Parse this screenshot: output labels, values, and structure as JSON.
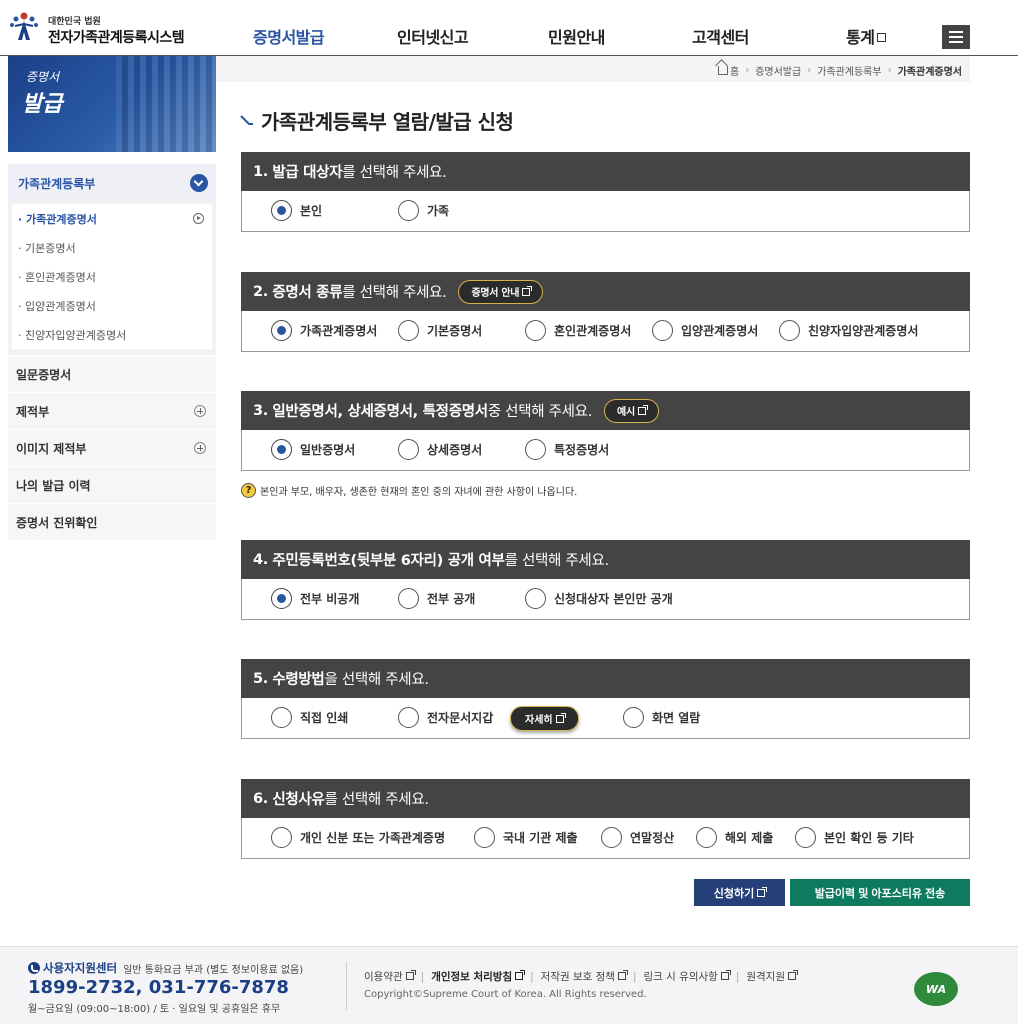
{
  "header": {
    "org_small": "대한민국 법원",
    "system_name": "전자가족관계등록시스템",
    "nav": [
      {
        "label": "증명서발급",
        "active": true
      },
      {
        "label": "인터넷신고"
      },
      {
        "label": "민원안내"
      },
      {
        "label": "고객센터"
      },
      {
        "label": "통계"
      }
    ]
  },
  "banner": {
    "line1": "증명서",
    "line2": "발급"
  },
  "sidebar": {
    "head": "가족관계등록부",
    "sub_items": [
      "· 가족관계증명서",
      "· 기본증명서",
      "· 혼인관계증명서",
      "· 입양관계증명서",
      "· 친양자입양관계증명서"
    ],
    "items": [
      "일문증명서",
      "제적부",
      "이미지 제적부",
      "나의 발급 이력",
      "증명서 진위확인"
    ]
  },
  "breadcrumb": {
    "home": "홈",
    "path": [
      "증명서발급",
      "가족관계등록부"
    ],
    "current": "가족관계증명서"
  },
  "page_title": "가족관계등록부 열람/발급 신청",
  "sections": [
    {
      "num": "1.",
      "bold": "발급 대상자",
      "rest": "를 선택해 주세요.",
      "options": [
        "본인",
        "가족"
      ],
      "checked": 0
    },
    {
      "num": "2.",
      "bold": "증명서 종류",
      "rest": "를 선택해 주세요.",
      "pill": "증명서 안내",
      "options": [
        "가족관계증명서",
        "기본증명서",
        "혼인관계증명서",
        "입양관계증명서",
        "친양자입양관계증명서"
      ],
      "checked": 0
    },
    {
      "num": "3.",
      "bold": "일반증명서, 상세증명서, 특정증명서",
      "rest": " 중 선택해 주세요.",
      "pill": "예시",
      "options": [
        "일반증명서",
        "상세증명서",
        "특정증명서"
      ],
      "checked": 0
    },
    {
      "num": "4.",
      "bold": "주민등록번호(뒷부분 6자리) 공개 여부",
      "rest": "를 선택해 주세요.",
      "options": [
        "전부 비공개",
        "전부 공개",
        "신청대상자 본인만 공개"
      ],
      "checked": 0
    },
    {
      "num": "5.",
      "bold": "수령방법",
      "rest": "을 선택해 주세요.",
      "options": [
        "직접 인쇄",
        "전자문서지갑",
        "화면 열람"
      ],
      "inline_pill": "자세히",
      "checked": -1
    },
    {
      "num": "6.",
      "bold": "신청사유",
      "rest": "를 선택해 주세요.",
      "options": [
        "개인 신분 또는 가족관계증명",
        "국내 기관 제출",
        "연말정산",
        "해외 제출",
        "본인 확인 등 기타"
      ],
      "checked": -1
    }
  ],
  "note": "본인과 부모, 배우자, 생존한 현재의 혼인 중의 자녀에 관한 사항이 나옵니다.",
  "buttons": {
    "apply": "신청하기",
    "history": "발급이력 및 아포스티유 전송"
  },
  "footer": {
    "center_title": "사용자지원센터",
    "center_note": "일반 통화요금 부과 (별도 정보이용료 없음)",
    "phone": "1899-2732, 031-776-7878",
    "hours": "월~금요일 (09:00~18:00) / 토 · 일요일 및 공휴일은 휴무",
    "links": [
      "이용약관",
      "개인정보 처리방침",
      "저작권 보호 정책",
      "링크 시 유의사항",
      "원격지원"
    ],
    "copyright": "Copyright©Supreme Court of Korea. All Rights reserved.",
    "wa_mark": "WA"
  },
  "colors": {
    "primary": "#2a55a5",
    "section_head": "#444444",
    "apply_btn": "#253f78",
    "history_btn": "#0e7a5e",
    "pill_border": "#d6b24a"
  }
}
